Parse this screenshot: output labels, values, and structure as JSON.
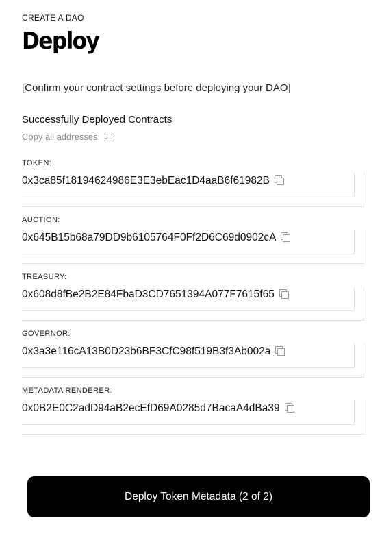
{
  "header": {
    "eyebrow": "CREATE A DAO",
    "title": "Deploy"
  },
  "confirm_text": "[Confirm your contract settings before deploying your DAO]",
  "deployed": {
    "section_title": "Successfully Deployed Contracts",
    "copy_all_label": "Copy all addresses",
    "contracts": [
      {
        "label": "TOKEN:",
        "address": "0x3ca85f18194624986E3E3ebEac1D4aaB6f61982B"
      },
      {
        "label": "AUCTION:",
        "address": "0x645B15b68a79DD9b6105764F0Ff2D6C69d0902cA"
      },
      {
        "label": "TREASURY:",
        "address": "0x608d8fBe2B2E84FbaD3CD7651394A077F7615f65"
      },
      {
        "label": "GOVERNOR:",
        "address": "0x3a3e116cA13B0D23b6BF3CfC98f519B3f3Ab002a"
      },
      {
        "label": "METADATA RENDERER:",
        "address": "0x0B2E0C2adD94aB2ecEfD69A0285d7BacaA4dBa39"
      }
    ]
  },
  "action": {
    "deploy_label": "Deploy Token Metadata (2 of 2)"
  },
  "icons": {
    "copy": "copy-icon"
  },
  "colors": {
    "button_bg": "#000000",
    "button_text": "#ffffff",
    "muted_text": "#888888"
  }
}
